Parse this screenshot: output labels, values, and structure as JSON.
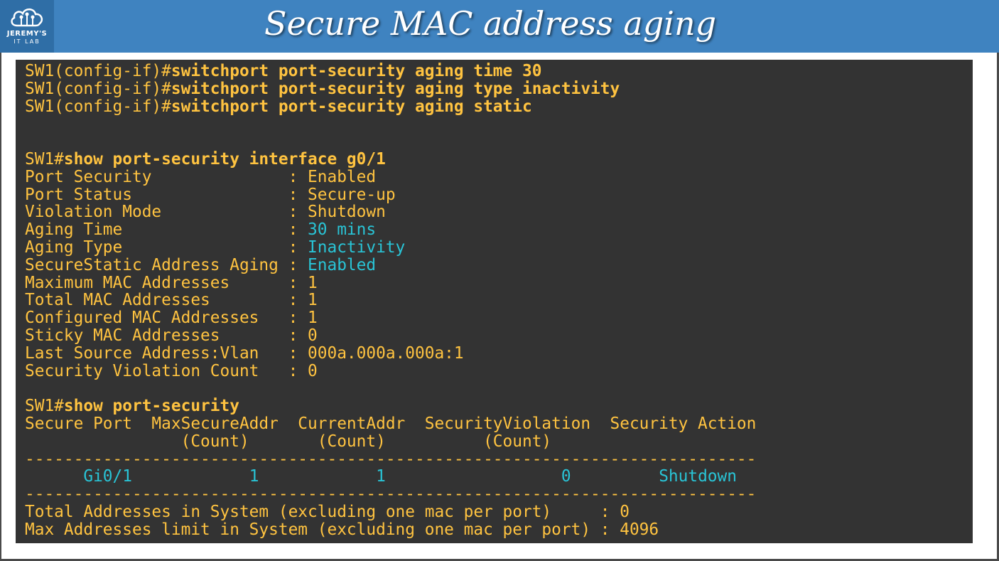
{
  "header": {
    "title": "Secure MAC address aging",
    "logo_line1": "JEREMY'S",
    "logo_line2": "IT LAB",
    "logo_icon": "cloud-circuit-icon",
    "background_color": "#3f83c0"
  },
  "terminal": {
    "background_color": "#333333",
    "text_color": "#ffc340",
    "highlight_color": "#29c4d6",
    "config_commands": [
      {
        "prompt": "SW1(config-if)#",
        "command": "switchport port-security aging time 30"
      },
      {
        "prompt": "SW1(config-if)#",
        "command": "switchport port-security aging type inactivity"
      },
      {
        "prompt": "SW1(config-if)#",
        "command": "switchport port-security aging static"
      }
    ],
    "show_interface": {
      "prompt": "SW1#",
      "command": "show port-security interface g0/1",
      "fields": [
        {
          "label": "Port Security              ",
          "value": "Enabled",
          "highlight": false
        },
        {
          "label": "Port Status                ",
          "value": "Secure-up",
          "highlight": false
        },
        {
          "label": "Violation Mode             ",
          "value": "Shutdown",
          "highlight": false
        },
        {
          "label": "Aging Time                 ",
          "value": "30 mins",
          "highlight": true
        },
        {
          "label": "Aging Type                 ",
          "value": "Inactivity",
          "highlight": true
        },
        {
          "label": "SecureStatic Address Aging ",
          "value": "Enabled",
          "highlight": true
        },
        {
          "label": "Maximum MAC Addresses      ",
          "value": "1",
          "highlight": false
        },
        {
          "label": "Total MAC Addresses        ",
          "value": "1",
          "highlight": false
        },
        {
          "label": "Configured MAC Addresses   ",
          "value": "1",
          "highlight": false
        },
        {
          "label": "Sticky MAC Addresses       ",
          "value": "0",
          "highlight": false
        },
        {
          "label": "Last Source Address:Vlan   ",
          "value": "000a.000a.000a:1",
          "highlight": false
        },
        {
          "label": "Security Violation Count   ",
          "value": "0",
          "highlight": false
        }
      ]
    },
    "show_summary": {
      "prompt": "SW1#",
      "command": "show port-security",
      "header_line1": "Secure Port  MaxSecureAddr  CurrentAddr  SecurityViolation  Security Action",
      "header_line2": "                (Count)       (Count)          (Count)",
      "separator": "---------------------------------------------------------------------------",
      "row": {
        "port": "Gi0/1",
        "max_secure": "1",
        "current": "1",
        "violations": "0",
        "action": "Shutdown"
      },
      "footer": [
        {
          "label": "Total Addresses in System (excluding one mac per port)     : ",
          "value": "0"
        },
        {
          "label": "Max Addresses limit in System (excluding one mac per port) : ",
          "value": "4096"
        }
      ]
    }
  }
}
